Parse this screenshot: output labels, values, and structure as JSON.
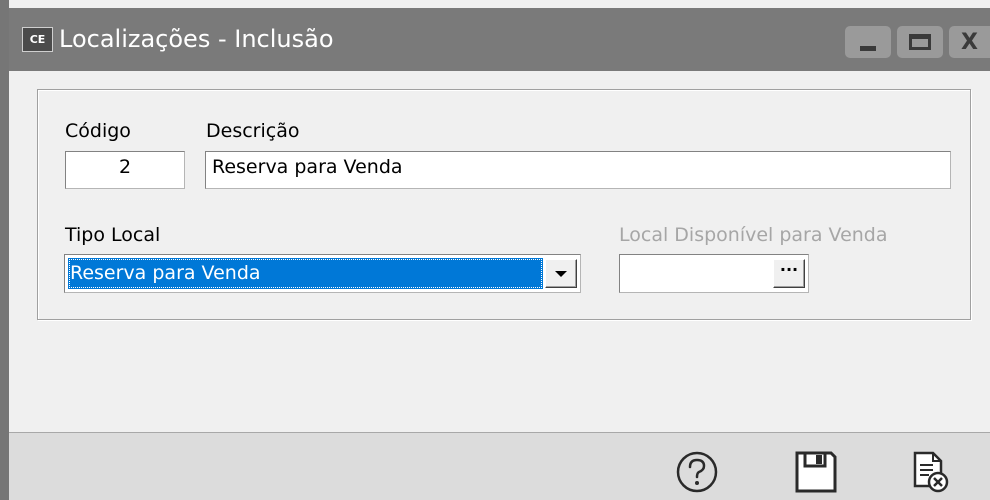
{
  "window": {
    "app_icon_text": "CE",
    "title": "Localizações - Inclusão",
    "minimize_icon": "minimize-icon",
    "maximize_icon": "maximize-icon",
    "close_icon": "close-icon",
    "close_glyph": "X"
  },
  "form": {
    "codigo": {
      "label": "Código",
      "value": "2"
    },
    "descricao": {
      "label": "Descrição",
      "value": "Reserva para Venda"
    },
    "tipo_local": {
      "label": "Tipo Local",
      "selected": "Reserva para Venda"
    },
    "local_disponivel": {
      "label": "Local Disponível para Venda",
      "value": "",
      "button_label": "···",
      "disabled": true
    }
  },
  "footer": {
    "help_icon": "help-icon",
    "save_icon": "save-icon",
    "cancel_icon": "cancel-document-icon"
  },
  "colors": {
    "titlebar": "#7a7a7a",
    "selection": "#0078d7",
    "disabled_text": "#a6a6a6"
  }
}
